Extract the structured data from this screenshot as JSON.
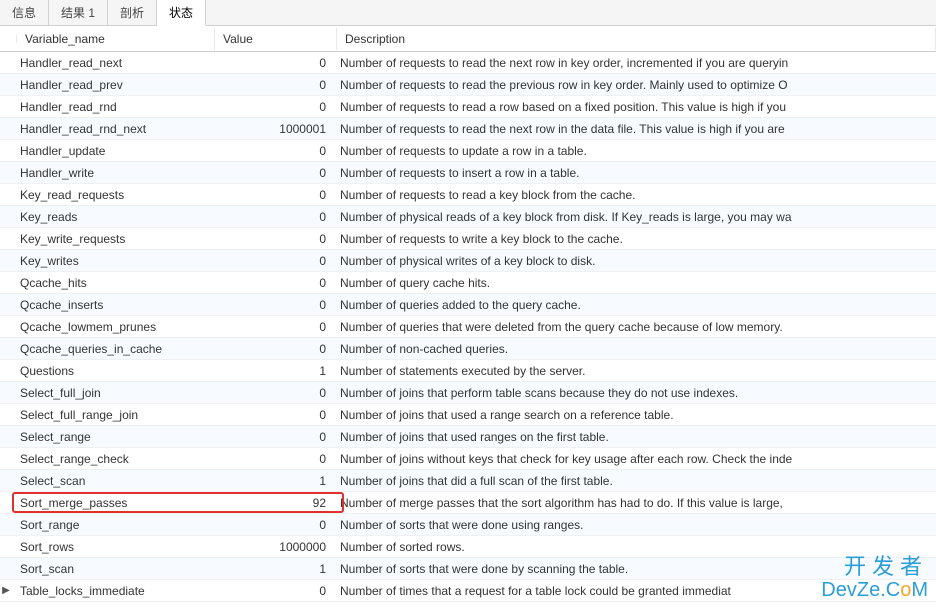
{
  "tabs": [
    {
      "label": "信息"
    },
    {
      "label": "结果 1"
    },
    {
      "label": "剖析"
    },
    {
      "label": "状态"
    }
  ],
  "active_tab_index": 3,
  "columns": {
    "name": "Variable_name",
    "value": "Value",
    "desc": "Description"
  },
  "rows": [
    {
      "name": "Handler_read_next",
      "value": "0",
      "desc": "Number of requests to read the next row in key order, incremented if you are queryin"
    },
    {
      "name": "Handler_read_prev",
      "value": "0",
      "desc": "Number of requests to read the previous row in key order. Mainly used to optimize O"
    },
    {
      "name": "Handler_read_rnd",
      "value": "0",
      "desc": "Number of requests to read a row based on a fixed position. This value is high if you"
    },
    {
      "name": "Handler_read_rnd_next",
      "value": "1000001",
      "desc": "Number of requests to read the next row in the data file. This value is high if you are"
    },
    {
      "name": "Handler_update",
      "value": "0",
      "desc": "Number of requests to update a row in a table."
    },
    {
      "name": "Handler_write",
      "value": "0",
      "desc": "Number of requests to insert a row in a table."
    },
    {
      "name": "Key_read_requests",
      "value": "0",
      "desc": "Number of requests to read a key block from the cache."
    },
    {
      "name": "Key_reads",
      "value": "0",
      "desc": "Number of physical reads of a key block from disk. If Key_reads is large, you may wa"
    },
    {
      "name": "Key_write_requests",
      "value": "0",
      "desc": "Number of requests to write a key block to the cache."
    },
    {
      "name": "Key_writes",
      "value": "0",
      "desc": "Number of physical writes of a key block to disk."
    },
    {
      "name": "Qcache_hits",
      "value": "0",
      "desc": "Number of query cache hits."
    },
    {
      "name": "Qcache_inserts",
      "value": "0",
      "desc": "Number of queries added to the query cache."
    },
    {
      "name": "Qcache_lowmem_prunes",
      "value": "0",
      "desc": "Number of queries that were deleted from the query cache because of low memory."
    },
    {
      "name": "Qcache_queries_in_cache",
      "value": "0",
      "desc": "Number of non-cached queries."
    },
    {
      "name": "Questions",
      "value": "1",
      "desc": "Number of statements executed by the server."
    },
    {
      "name": "Select_full_join",
      "value": "0",
      "desc": "Number of joins that perform table scans because they do not use indexes."
    },
    {
      "name": "Select_full_range_join",
      "value": "0",
      "desc": "Number of joins that used a range search on a reference table."
    },
    {
      "name": "Select_range",
      "value": "0",
      "desc": "Number of joins that used ranges on the first table."
    },
    {
      "name": "Select_range_check",
      "value": "0",
      "desc": "Number of joins without keys that check for key usage after each row. Check the inde"
    },
    {
      "name": "Select_scan",
      "value": "1",
      "desc": "Number of joins that did a full scan of the first table."
    },
    {
      "name": "Sort_merge_passes",
      "value": "92",
      "desc": "Number of merge passes that the sort algorithm has had to do. If this value is large,",
      "highlighted": true
    },
    {
      "name": "Sort_range",
      "value": "0",
      "desc": "Number of sorts that were done using ranges."
    },
    {
      "name": "Sort_rows",
      "value": "1000000",
      "desc": "Number of sorted rows."
    },
    {
      "name": "Sort_scan",
      "value": "1",
      "desc": "Number of sorts that were done by scanning the table."
    },
    {
      "name": "Table_locks_immediate",
      "value": "0",
      "desc": "Number of times that a request for a table lock could be granted immediat",
      "indicator": true
    }
  ],
  "watermark": {
    "cn": "开发者",
    "en_pre": "DevZe.C",
    "en_o": "o",
    "en_post": "M"
  }
}
